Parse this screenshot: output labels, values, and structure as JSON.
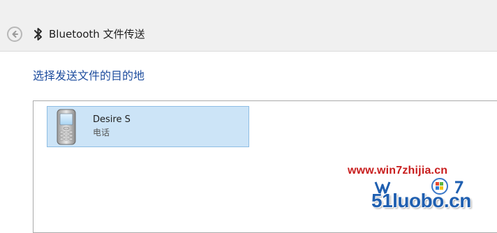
{
  "window": {
    "title": "Bluetooth 文件传送",
    "back_icon": "back-arrow-icon",
    "bluetooth_icon": "bluetooth-icon"
  },
  "main": {
    "heading": "选择发送文件的目的地",
    "devices": [
      {
        "name": "Desire S",
        "type": "电话",
        "icon": "phone-icon",
        "selected": true
      }
    ]
  },
  "watermark": {
    "url": "www.win7zhijia.cn",
    "brand": "51luobo.cn"
  },
  "colors": {
    "accent_heading": "#1e4d9e",
    "selection_fill": "#cce4f7",
    "selection_border": "#8ebde4",
    "watermark_url": "#c81e1e",
    "watermark_brand": "#1f5fb0"
  }
}
